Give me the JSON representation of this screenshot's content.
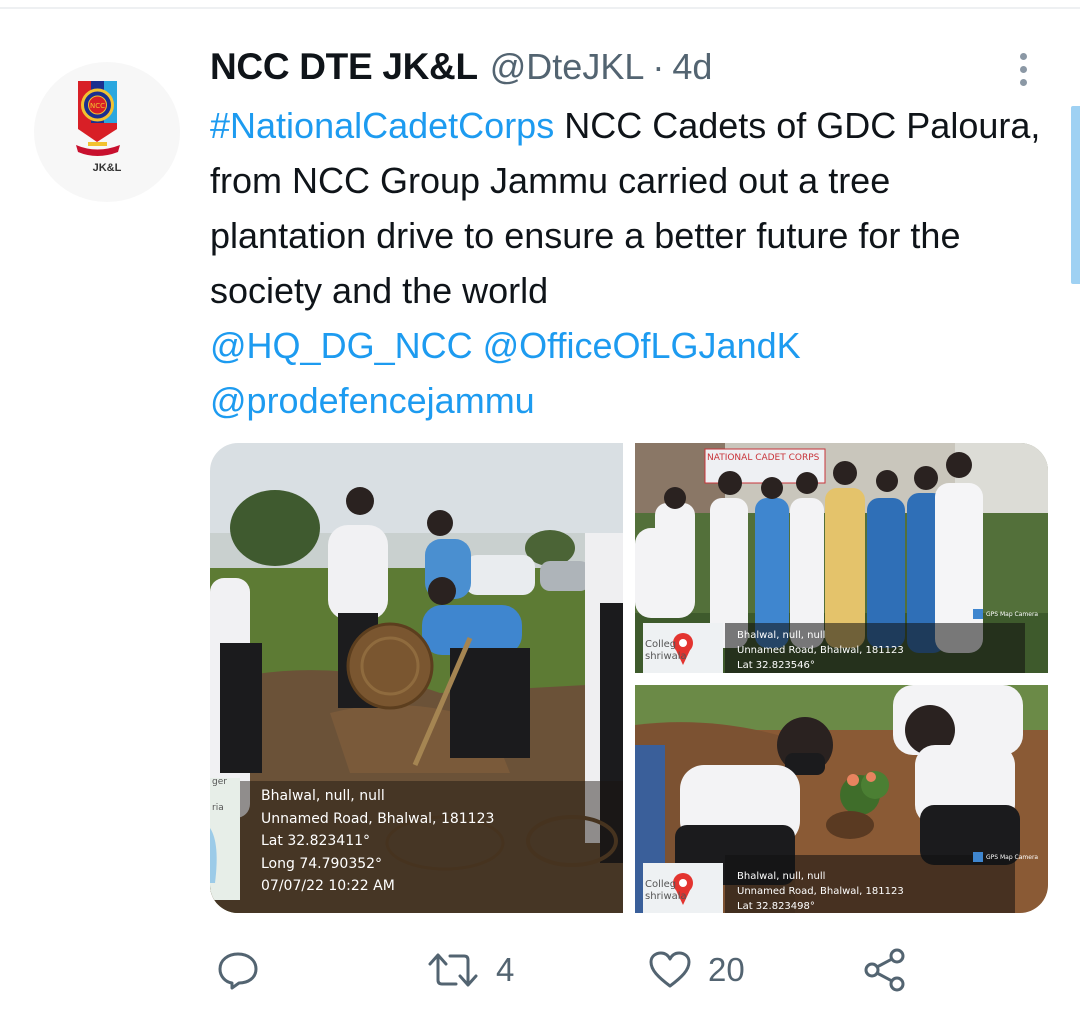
{
  "tweet": {
    "display_name": "NCC DTE JK&L",
    "handle": "@DteJKL",
    "separator": "·",
    "time": "4d",
    "avatar_text": "JK&L",
    "avatar_badge_text": "NCC",
    "text_parts": {
      "hashtag": "#NationalCadetCorps",
      "body": " NCC Cadets of GDC Paloura, from NCC Group Jammu carried out a tree plantation drive to ensure a better future for the society and the world",
      "mention1": "@HQ_DG_NCC",
      "mention2": "@OfficeOfLGJandK",
      "mention3": "@prodefencejammu"
    }
  },
  "media": {
    "photo1": {
      "map_labels": [
        "ger",
        "ria"
      ],
      "caption": [
        "Bhalwal, null, null",
        "Unnamed Road, Bhalwal, 181123",
        "Lat 32.823411°",
        "Long 74.790352°",
        "07/07/22 10:22 AM"
      ]
    },
    "photo2": {
      "banner": "NATIONAL CADET CORPS",
      "map_labels": [
        "Colleg",
        "shriwala"
      ],
      "watermark": "GPS Map Camera",
      "caption": [
        "Bhalwal, null, null",
        "Unnamed Road, Bhalwal, 181123",
        "Lat 32.823546°"
      ]
    },
    "photo3": {
      "map_labels": [
        "Colleg",
        "shriwala"
      ],
      "watermark": "GPS Map Camera",
      "caption": [
        "Bhalwal, null, null",
        "Unnamed Road, Bhalwal, 181123",
        "Lat 32.823498°"
      ]
    }
  },
  "actions": {
    "reply": {
      "icon": "reply-icon",
      "count": ""
    },
    "retweet": {
      "icon": "retweet-icon",
      "count": "4"
    },
    "like": {
      "icon": "heart-icon",
      "count": "20"
    },
    "share": {
      "icon": "share-icon",
      "count": ""
    }
  },
  "colors": {
    "link": "#1d9bf0",
    "secondary_text": "#536471",
    "primary_text": "#0f1419",
    "scrollbar": "#9fd1f3"
  }
}
